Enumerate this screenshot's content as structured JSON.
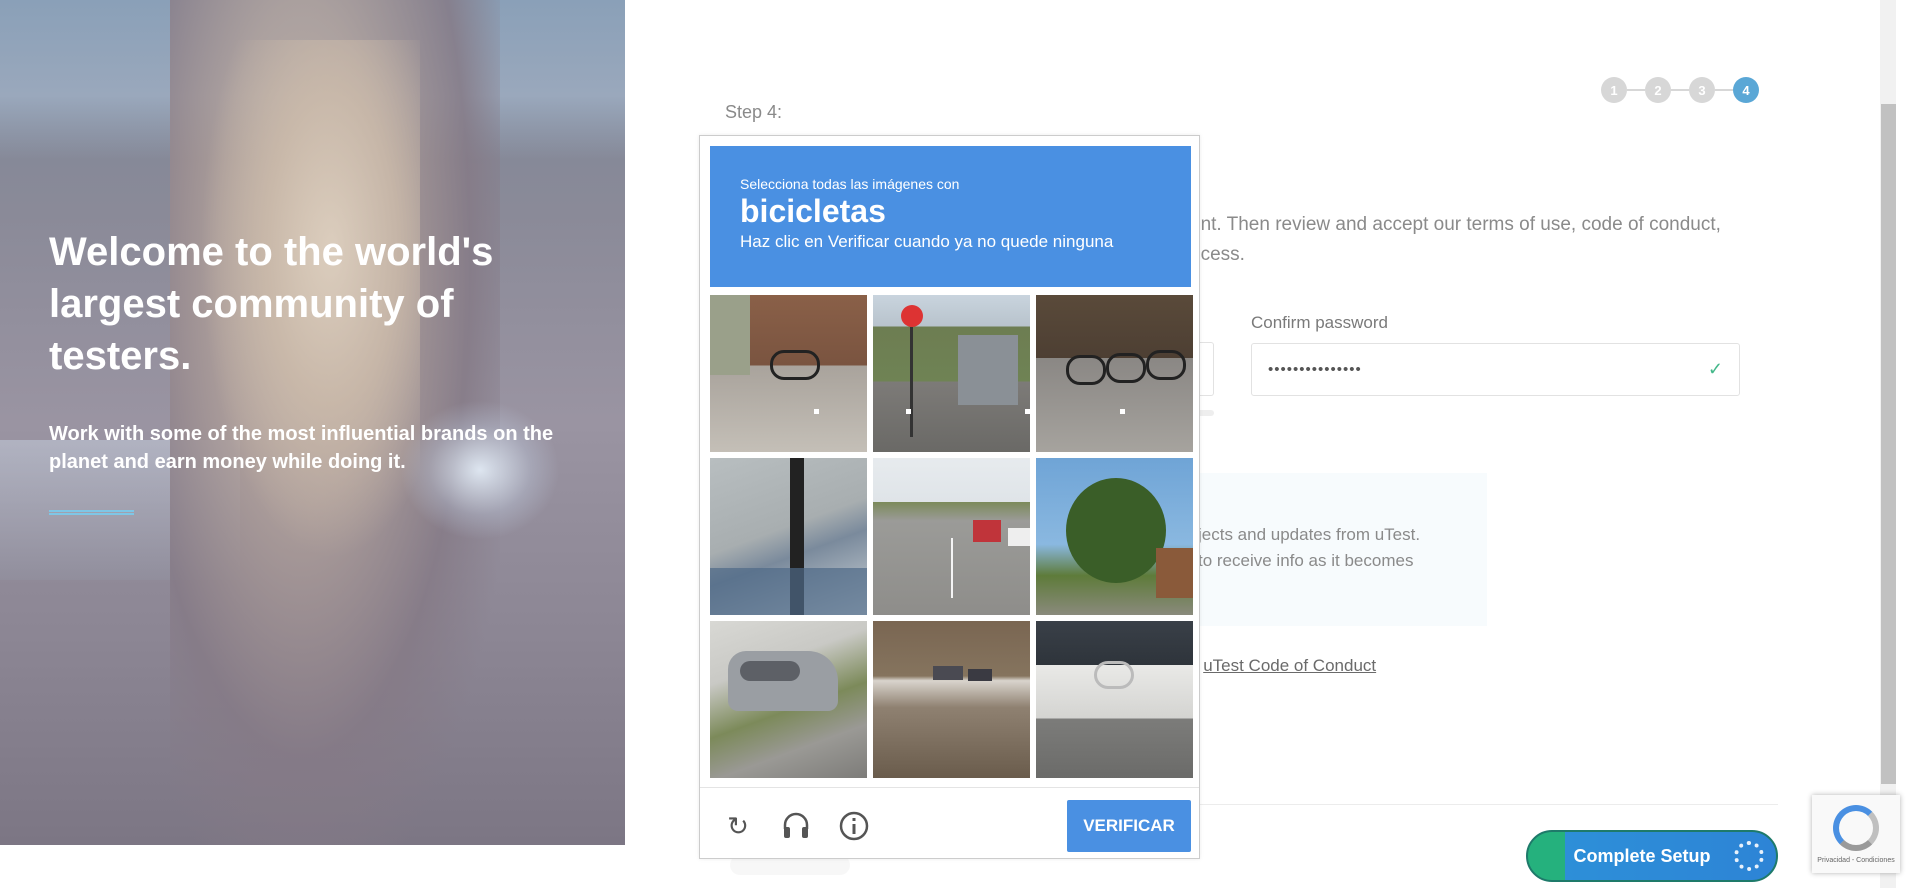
{
  "hero": {
    "title": "Welcome to the world's largest community of testers.",
    "subtitle": "Work with some of the most influential brands on the planet and earn money while doing it."
  },
  "stepper": {
    "steps": [
      "1",
      "2",
      "3",
      "4"
    ],
    "active": "4"
  },
  "form": {
    "step_label": "Step 4:",
    "intro_line1": "unt. Then review and accept our terms of use, code of conduct,",
    "intro_line2": "ocess.",
    "confirm_label": "Confirm password",
    "confirm_value": "•••••••••••••••",
    "news_line1": "jects and updates from uTest.",
    "news_line2": "to receive info as it becomes",
    "conduct_prefix": "e ",
    "conduct_link": "uTest Code of Conduct",
    "complete_button": "Complete Setup"
  },
  "captcha": {
    "prompt_small": "Selecciona todas las imágenes con",
    "prompt_target": "bicicletas",
    "prompt_hint": "Haz clic en Verificar cuando ya no quede ninguna",
    "verify_label": "VERIFICAR",
    "tiles": [
      "bikes-by-garage",
      "stop-sign-street",
      "bikes-on-rack",
      "overhang-building",
      "road-with-cars",
      "tree-by-house",
      "parked-silver-car",
      "snowy-street",
      "bike-by-wall"
    ]
  },
  "recaptcha_badge": {
    "text": "Privacidad - Condiciones"
  },
  "colors": {
    "captcha_blue": "#4a90e2",
    "step_active": "#5aa7d6",
    "complete_green": "#25b17d"
  }
}
